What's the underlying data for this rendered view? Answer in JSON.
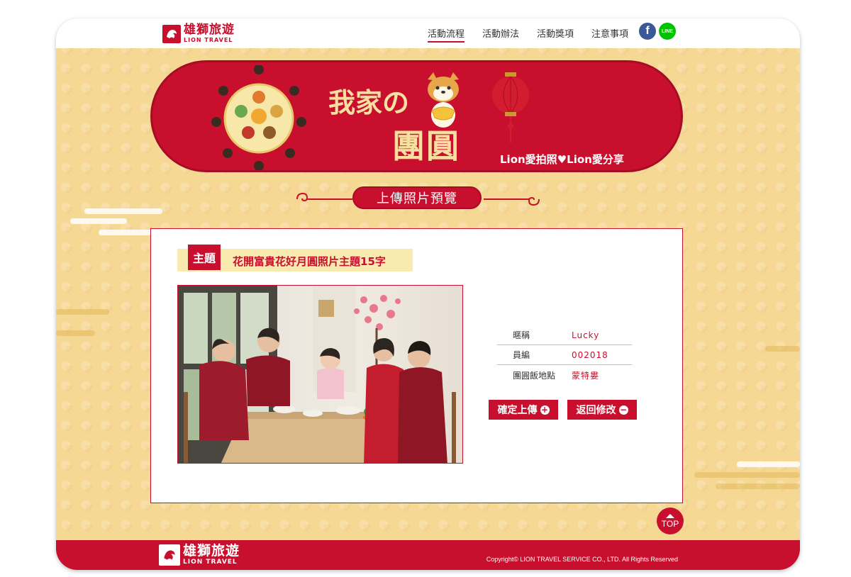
{
  "header": {
    "logo_cn": "雄獅旅遊",
    "logo_en": "LION TRAVEL",
    "nav": [
      {
        "label": "活動流程",
        "active": true
      },
      {
        "label": "活動辦法",
        "active": false
      },
      {
        "label": "活動獎項",
        "active": false
      },
      {
        "label": "注意事項",
        "active": false
      }
    ],
    "social": {
      "facebook": "f",
      "line": "LINE"
    }
  },
  "banner": {
    "title_a": "我家の",
    "title_b": "團圓飯",
    "slogan": "Lion愛拍照♥Lion愛分享"
  },
  "section_title": "上傳照片預覽",
  "subject": {
    "tag": "主題",
    "text": "花開富貴花好月圓照片主題15字"
  },
  "info": [
    {
      "label": "暱稱",
      "value": "Lucky"
    },
    {
      "label": "員編",
      "value": "002018"
    },
    {
      "label": "團圓飯地點",
      "value": "蒙特婁"
    }
  ],
  "buttons": {
    "confirm": "確定上傳",
    "back": "返回修改"
  },
  "top_label": "TOP",
  "footer": {
    "copyright": "Copyright© LION TRAVEL SERVICE CO., LTD. All Rights Reserved"
  },
  "colors": {
    "brand_red": "#c8102e",
    "background_gold": "#f6d895",
    "cream": "#f9eab0"
  }
}
